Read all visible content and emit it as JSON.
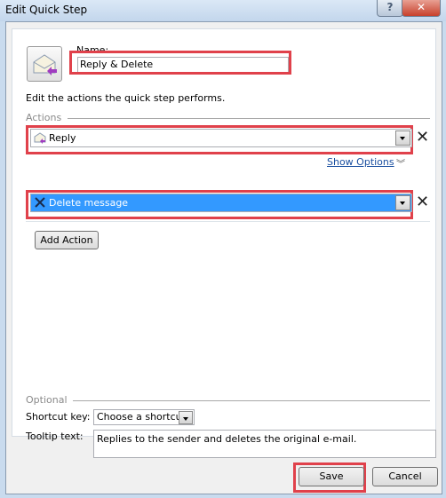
{
  "window": {
    "title": "Edit Quick Step",
    "help_glyph": "?",
    "close_glyph": "✕"
  },
  "header": {
    "icon": "reply-envelope-icon",
    "name_label": "Name:",
    "name_value": "Reply & Delete",
    "instructions": "Edit the actions the quick step performs."
  },
  "actions": {
    "group_label": "Actions",
    "items": [
      {
        "label": "Reply",
        "icon": "reply-envelope-icon",
        "selected": false
      },
      {
        "label": "Delete message",
        "icon": "delete-x-icon",
        "selected": true
      }
    ],
    "remove_glyph": "✕",
    "show_options_label": "Show Options",
    "show_options_glyph": "»",
    "add_action_label": "Add Action"
  },
  "optional": {
    "group_label": "Optional",
    "shortcut_label": "Shortcut key:",
    "shortcut_value": "Choose a shortcut",
    "tooltip_label": "Tooltip text:",
    "tooltip_value": "Replies to the sender and deletes the original e-mail."
  },
  "footer": {
    "save_label": "Save",
    "cancel_label": "Cancel"
  },
  "colors": {
    "highlight": "#e0414b",
    "selection": "#3399ff",
    "link": "#1a4fa0"
  }
}
